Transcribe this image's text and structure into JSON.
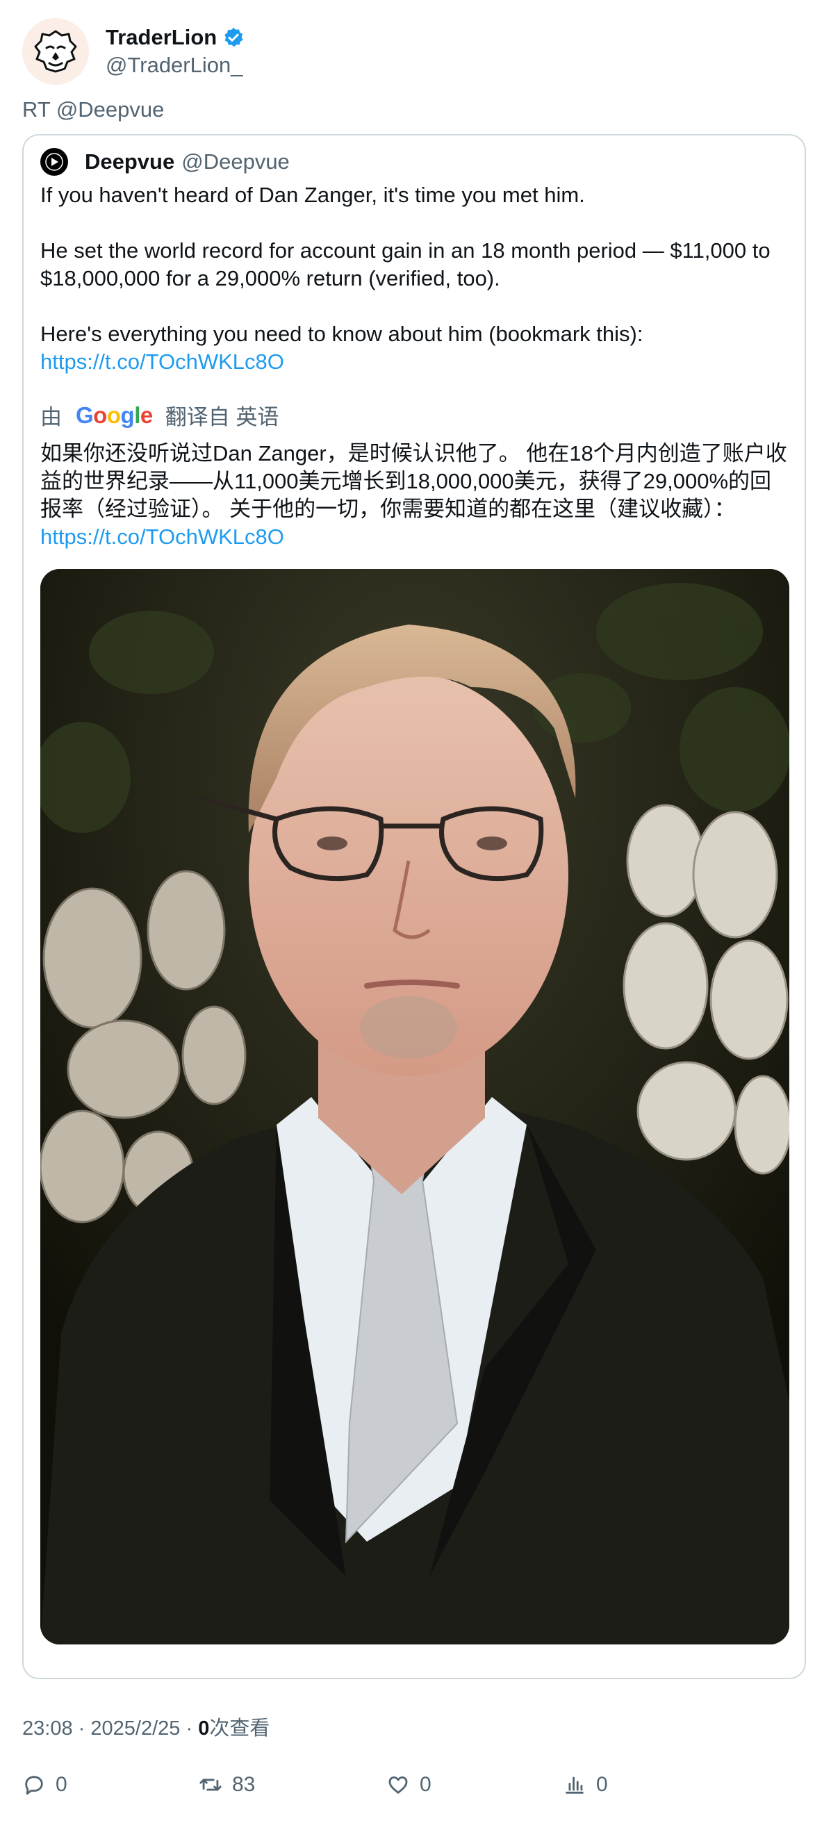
{
  "author": {
    "display_name": "TraderLion",
    "handle": "@TraderLion_",
    "verified_icon": "verified-badge-icon",
    "avatar_icon": "lion-avatar-icon"
  },
  "rt_line": "RT @Deepvue",
  "quoted": {
    "display_name": "Deepvue",
    "handle": "@Deepvue",
    "line1": "If you haven't heard of Dan Zanger, it's time you met him.",
    "line2": "He set the world record for account gain in an 18 month period — $11,000 to $18,000,000 for a 29,000% return (verified, too).",
    "line3": "Here's everything you need to know about him (bookmark this):",
    "link": "https://t.co/TOchWKLc8O",
    "translate_prefix": "由",
    "translate_google": "Google",
    "translate_suffix": "翻译自 英语",
    "zh_text": "如果你还没听说过Dan Zanger，是时候认识他了。 他在18个月内创造了账户收益的世界纪录——从11,000美元增长到18,000,000美元，获得了29,000%的回报率（经过验证）。 关于他的一切，你需要知道的都在这里（建议收藏）：",
    "zh_link": "https://t.co/TOchWKLc8O",
    "image_icon": "portrait-photo"
  },
  "meta": {
    "time": "23:08",
    "sep1": "·",
    "date": "2025/2/25",
    "sep2": "·",
    "views": "0",
    "views_label": "次查看"
  },
  "actions": {
    "reply": {
      "icon": "reply-icon",
      "count": "0"
    },
    "retweet": {
      "icon": "retweet-icon",
      "count": "83"
    },
    "like": {
      "icon": "heart-icon",
      "count": "0"
    },
    "views": {
      "icon": "views-chart-icon",
      "count": "0"
    }
  }
}
